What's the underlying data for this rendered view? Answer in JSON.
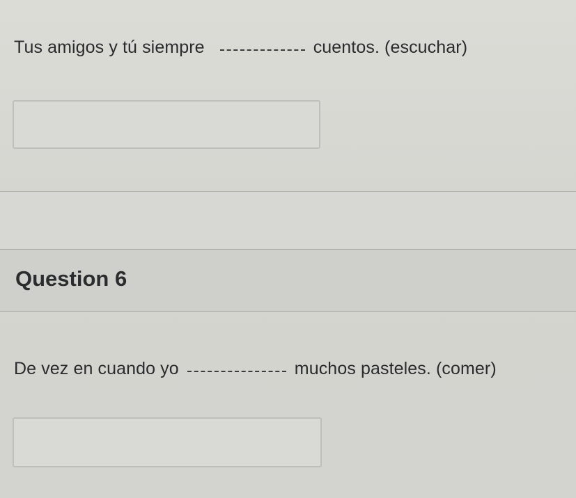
{
  "question5": {
    "prompt_before": "Tus amigos y tú  siempre",
    "prompt_after": "cuentos. (escuchar)",
    "answer_value": ""
  },
  "question6": {
    "title": "Question 6",
    "prompt_before": "De vez en cuando yo",
    "prompt_after": "muchos pasteles. (comer)",
    "answer_value": ""
  }
}
